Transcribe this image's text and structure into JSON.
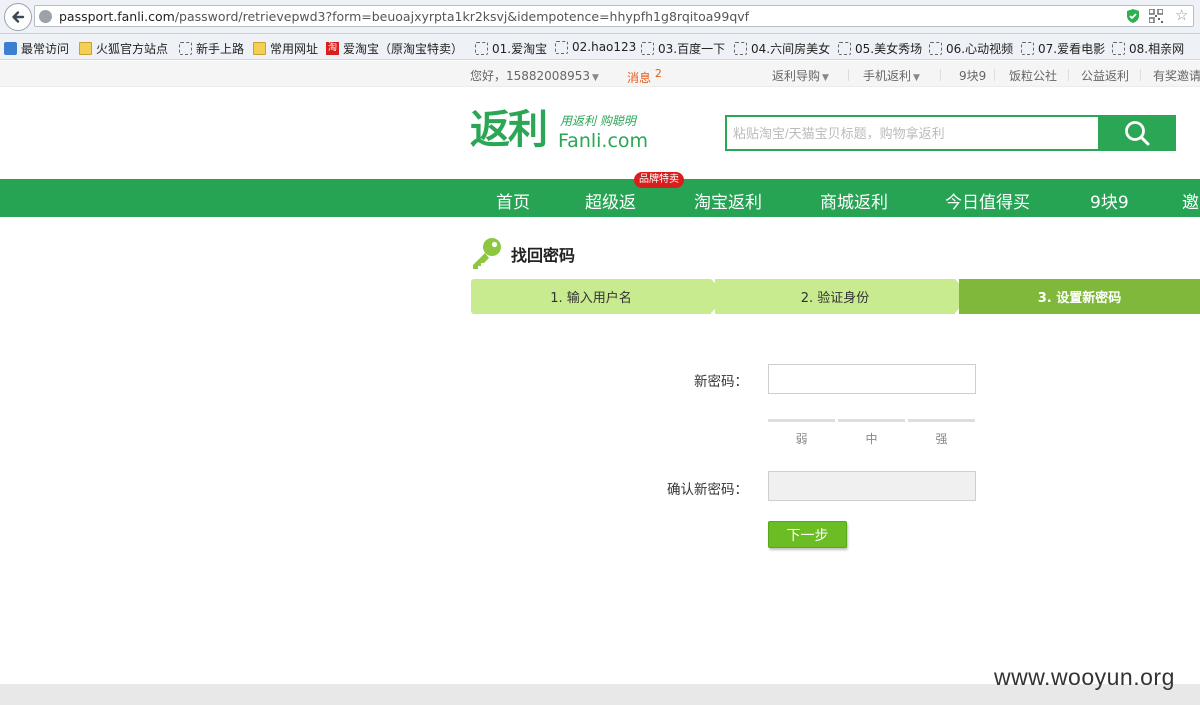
{
  "browser": {
    "url_host": "passport.fanli.com",
    "url_path": "/password/retrievepwd3?form=beuoajxyrpta1kr2ksvj&idempotence=hhypfh1g8rqitoa99qvf",
    "bookmarks": [
      "最常访问",
      "火狐官方站点",
      "新手上路",
      "常用网址",
      "爱淘宝（原淘宝特卖）",
      "01.爱淘宝",
      "02.hao123",
      "03.百度一下",
      "04.六间房美女",
      "05.美女秀场",
      "06.心动视频",
      "07.爱看电影",
      "08.相亲网"
    ],
    "taobao_icon_text": "淘"
  },
  "topbar": {
    "greeting": "您好，15882008953",
    "messages": "消息",
    "message_count": "2",
    "links": [
      "返利导购",
      "手机返利",
      "9块9",
      "饭粒公社",
      "公益返利",
      "有奖邀请"
    ]
  },
  "header": {
    "logo_cn": "返利",
    "logo_slogan": "用返利 购聪明",
    "logo_en": "Fanli.com",
    "search_placeholder": "粘贴淘宝/天猫宝贝标题，购物拿返利"
  },
  "nav": {
    "items": [
      "首页",
      "超级返",
      "淘宝返利",
      "商城返利",
      "今日值得买",
      "9块9",
      "邀"
    ],
    "badge": "品牌特卖"
  },
  "page": {
    "title": "找回密码",
    "steps": [
      "1. 输入用户名",
      "2. 验证身份",
      "3. 设置新密码"
    ],
    "active_step": 3
  },
  "form": {
    "new_password_label": "新密码：",
    "strength": [
      "弱",
      "中",
      "强"
    ],
    "confirm_label": "确认新密码：",
    "next_button": "下一步"
  },
  "watermark": "www.wooyun.org",
  "colors": {
    "brand_green": "#27a354",
    "step_light": "#c7eb8e",
    "step_active": "#7fb83a",
    "button_green": "#6bbd24",
    "badge_red": "#d91e1e",
    "message_orange": "#e85a1a"
  }
}
